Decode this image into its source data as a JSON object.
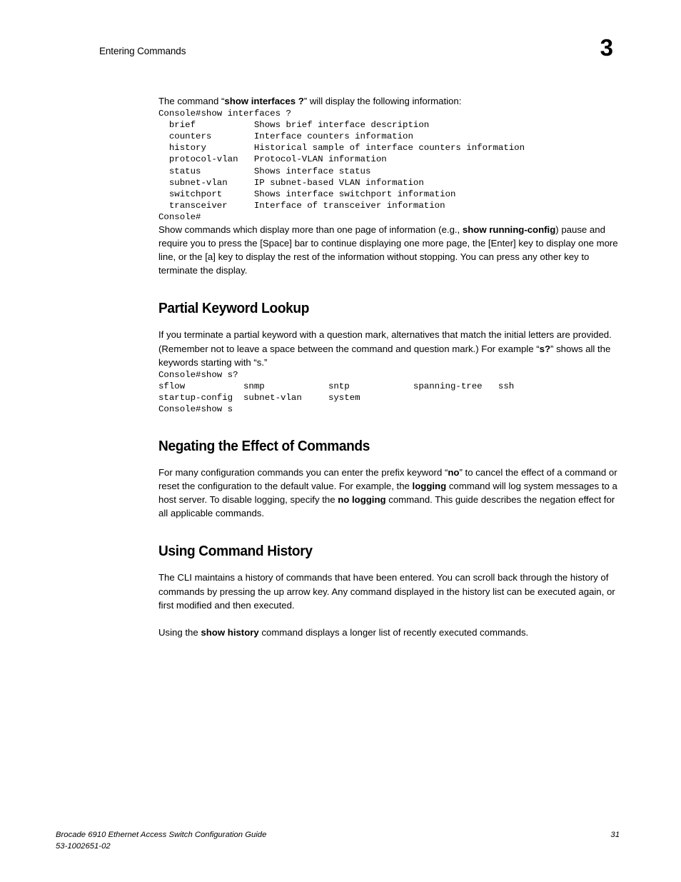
{
  "header": {
    "running_title": "Entering Commands",
    "chapter_number": "3"
  },
  "body": {
    "intro_before": "The command “",
    "intro_bold": "show interfaces ?",
    "intro_after": "” will display the following information:",
    "cli_block_1": "Console#show interfaces ?\n  brief           Shows brief interface description\n  counters        Interface counters information\n  history         Historical sample of interface counters information\n  protocol-vlan   Protocol-VLAN information\n  status          Shows interface status\n  subnet-vlan     IP subnet-based VLAN information\n  switchport      Shows interface switchport information\n  transceiver     Interface of transceiver information\nConsole#",
    "paging_para_1": "Show commands which display more than one page of information (e.g., ",
    "paging_bold": "show running-config",
    "paging_para_2": ") pause and require you to press the [Space] bar to continue displaying one more page, the [Enter] key to display one more line, or the [a] key to display the rest of the information without stopping. You can press any other key to terminate the display."
  },
  "sections": {
    "partial_keyword": {
      "heading": "Partial Keyword Lookup",
      "para_1": "If you terminate a partial keyword with a question mark, alternatives that match the initial letters are provided. (Remember not to leave a space between the command and question mark.) For example “",
      "para_bold": "s?",
      "para_2": "” shows all the keywords starting with “s.”",
      "cli_block": "Console#show s?\nsflow           snmp            sntp            spanning-tree   ssh\nstartup-config  subnet-vlan     system\nConsole#show s"
    },
    "negating": {
      "heading": "Negating the Effect of Commands",
      "para_1": "For many configuration commands you can enter the prefix keyword “",
      "bold_1": "no",
      "para_2": "” to cancel the effect of a command or reset the configuration to the default value. For example, the ",
      "bold_2": "logging",
      "para_3": " command will log system messages to a host server. To disable logging, specify the ",
      "bold_3": "no logging",
      "para_4": " command. This guide describes the negation effect for all applicable commands."
    },
    "command_history": {
      "heading": "Using Command History",
      "para_1": "The CLI maintains a history of commands that have been entered. You can scroll back through the history of commands by pressing the up arrow key. Any command displayed in the history list can be executed again, or first modified and then executed.",
      "para_2_before": "Using the ",
      "para_2_bold": "show history",
      "para_2_after": " command displays a longer list of recently executed commands."
    }
  },
  "footer": {
    "guide_title": "Brocade 6910 Ethernet Access Switch Configuration Guide",
    "document_number": "53-1002651-02",
    "page_number": "31"
  }
}
